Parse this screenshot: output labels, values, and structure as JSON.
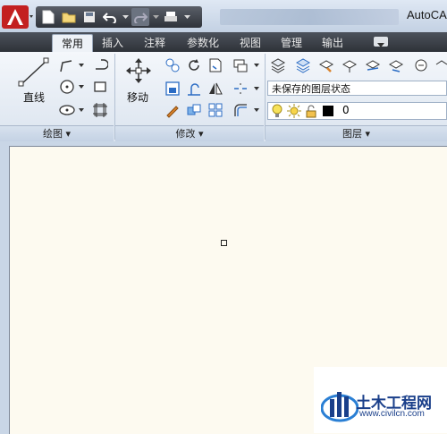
{
  "window": {
    "title": "AutoCA"
  },
  "tabs": [
    {
      "label": "常用",
      "active": true
    },
    {
      "label": "插入",
      "active": false
    },
    {
      "label": "注释",
      "active": false
    },
    {
      "label": "参数化",
      "active": false
    },
    {
      "label": "视图",
      "active": false
    },
    {
      "label": "管理",
      "active": false
    },
    {
      "label": "输出",
      "active": false
    }
  ],
  "ribbon": {
    "draw": {
      "line_label": "直线",
      "panel_title": "绘图 ▾"
    },
    "modify": {
      "move_label": "移动",
      "panel_title": "修改 ▾"
    },
    "layers": {
      "state_value": "未保存的图层状态",
      "current_layer": "0",
      "layer_color": "#000000",
      "panel_title": "图层 ▾"
    }
  },
  "watermark": {
    "title": "土木工程网",
    "url": "www.civilcn.com"
  },
  "colors": {
    "canvas": "#fdfaf0",
    "tabbar": "#3a3f47",
    "accent": "#1a3f8a"
  }
}
